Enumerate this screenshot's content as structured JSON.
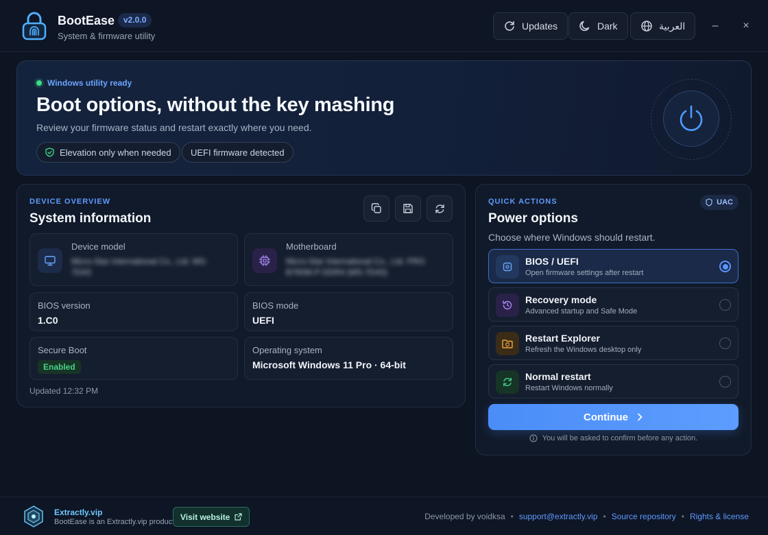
{
  "header": {
    "app_name": "BootEase",
    "version": "v2.0.0",
    "subtitle": "System & firmware utility",
    "updates_label": "Updates",
    "theme_label": "Dark",
    "language_label": "العربية",
    "minimize_glyph": "–",
    "close_glyph": "×"
  },
  "hero": {
    "status_text": "Windows utility ready",
    "title": "Boot options, without the key mashing",
    "subtitle": "Review your firmware status and restart exactly where you need.",
    "chips": [
      {
        "label": "Elevation only when needed",
        "icon": "shield-check-icon"
      },
      {
        "label": "UEFI firmware detected"
      }
    ]
  },
  "device": {
    "eyebrow": "DEVICE OVERVIEW",
    "title": "System information",
    "actions": [
      "copy-icon",
      "save-icon",
      "refresh-icon"
    ],
    "model_label": "Device model",
    "model_value": "Micro-Star International Co., Ltd. MS-7D43",
    "motherboard_label": "Motherboard",
    "motherboard_value": "Micro-Star International Co., Ltd. PRO B760M-P DDR4 (MS-7D43)",
    "bios_version_label": "BIOS version",
    "bios_version_value": "1.C0",
    "bios_mode_label": "BIOS mode",
    "bios_mode_value": "UEFI",
    "secure_boot_label": "Secure Boot",
    "secure_boot_value": "Enabled",
    "os_label": "Operating system",
    "os_value": "Microsoft Windows 11 Pro · 64-bit",
    "updated": "Updated 12:32 PM"
  },
  "actions": {
    "eyebrow": "QUICK ACTIONS",
    "title": "Power options",
    "uac_label": "UAC",
    "subtitle": "Choose where Windows should restart.",
    "options": [
      {
        "title": "BIOS / UEFI",
        "desc": "Open firmware settings after restart",
        "selected": true,
        "color": "#5b93ff"
      },
      {
        "title": "Recovery mode",
        "desc": "Advanced startup and Safe Mode",
        "selected": false,
        "color": "#a98bf5"
      },
      {
        "title": "Restart Explorer",
        "desc": "Refresh the Windows desktop only",
        "selected": false,
        "color": "#f0a43a"
      },
      {
        "title": "Normal restart",
        "desc": "Restart Windows normally",
        "selected": false,
        "color": "#3fcf86"
      }
    ],
    "continue_label": "Continue",
    "confirm_note": "You will be asked to confirm before any action."
  },
  "footer": {
    "brand": "Extractly.vip",
    "brand_sub": "BootEase is an Extractly.vip product",
    "visit_label": "Visit website",
    "developed_by": "Developed by voidksa",
    "email": "support@extractly.vip",
    "repo": "Source repository",
    "rights": "Rights & license",
    "separator": "•"
  },
  "colors": {
    "accent": "#5b93ff",
    "success": "#3ddc84",
    "background": "#0d1422"
  }
}
